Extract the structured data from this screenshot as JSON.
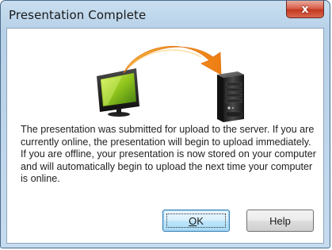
{
  "window": {
    "title": "Presentation Complete",
    "close_label": "x"
  },
  "illustration": {
    "source_icon": "monitor-icon",
    "arrow_icon": "curved-arrow-icon",
    "target_icon": "server-icon",
    "arrow_color": "#f39324"
  },
  "message": "The presentation was submitted for upload to the server. If you are currently online, the presentation will begin to upload immediately. If you are offline, your presentation is now stored on your computer and will automatically begin to upload the next time your computer is online.",
  "buttons": {
    "ok_label": "OK",
    "help_label": "Help"
  }
}
